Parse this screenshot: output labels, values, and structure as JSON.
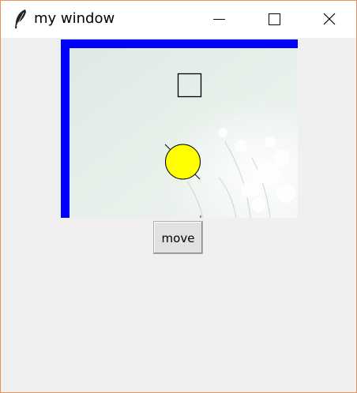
{
  "window": {
    "title": "my window",
    "accent_border": "#e8915a"
  },
  "titlebar": {
    "app_icon": "feather-icon",
    "minimize_icon": "minimize-icon",
    "maximize_icon": "maximize-icon",
    "close_icon": "close-icon"
  },
  "canvas": {
    "background_image": "dandelion-photo",
    "border_line_color": "#0000ff",
    "rectangle_outline_color": "#000000",
    "oval_fill_color": "#ffff00"
  },
  "controls": {
    "move_label": "move"
  }
}
